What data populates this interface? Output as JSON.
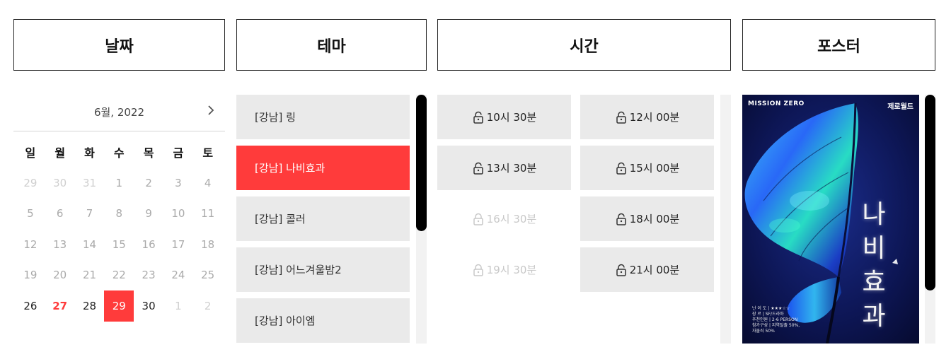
{
  "headers": {
    "date": "날짜",
    "theme": "테마",
    "time": "시간",
    "poster": "포스터"
  },
  "calendar": {
    "month_label": "6월, 2022",
    "weekdays": [
      "일",
      "월",
      "화",
      "수",
      "목",
      "금",
      "토"
    ],
    "weeks": [
      [
        "29",
        "30",
        "31",
        "1",
        "2",
        "3",
        "4"
      ],
      [
        "5",
        "6",
        "7",
        "8",
        "9",
        "10",
        "11"
      ],
      [
        "12",
        "13",
        "14",
        "15",
        "16",
        "17",
        "18"
      ],
      [
        "19",
        "20",
        "21",
        "22",
        "23",
        "24",
        "25"
      ],
      [
        "26",
        "27",
        "28",
        "29",
        "30",
        "1",
        "2"
      ]
    ],
    "selected": "29",
    "today": "27"
  },
  "themes": [
    {
      "label": "[강남] 링"
    },
    {
      "label": "[강남] 나비효과",
      "active": true
    },
    {
      "label": "[강남] 콜러"
    },
    {
      "label": "[강남] 어느겨울밤2"
    },
    {
      "label": "[강남] 아이엠"
    }
  ],
  "times": [
    [
      {
        "label": "10시 30분",
        "available": true
      },
      {
        "label": "12시 00분",
        "available": true
      }
    ],
    [
      {
        "label": "13시 30분",
        "available": true
      },
      {
        "label": "15시 00분",
        "available": true
      }
    ],
    [
      {
        "label": "16시 30분",
        "available": false
      },
      {
        "label": "18시 00분",
        "available": true
      }
    ],
    [
      {
        "label": "19시 30분",
        "available": false
      },
      {
        "label": "21시 00분",
        "available": true
      }
    ]
  ],
  "poster": {
    "logo_left": "MISSION ZERO",
    "logo_right": "제로월드",
    "title_chars": [
      "나",
      "비",
      "효",
      "과"
    ],
    "info_lines": [
      "난 이 도 | ★★★☆☆",
      "장    르 | SF/드라마",
      "추천인원 | 2-6 PERSON",
      "참가구성 | 지역탈출 50%,",
      "              자물쇠 50%"
    ]
  },
  "colors": {
    "accent": "#ff3b3b",
    "slot_bg": "#eaeaea",
    "disabled_text": "#c8c8c8"
  }
}
